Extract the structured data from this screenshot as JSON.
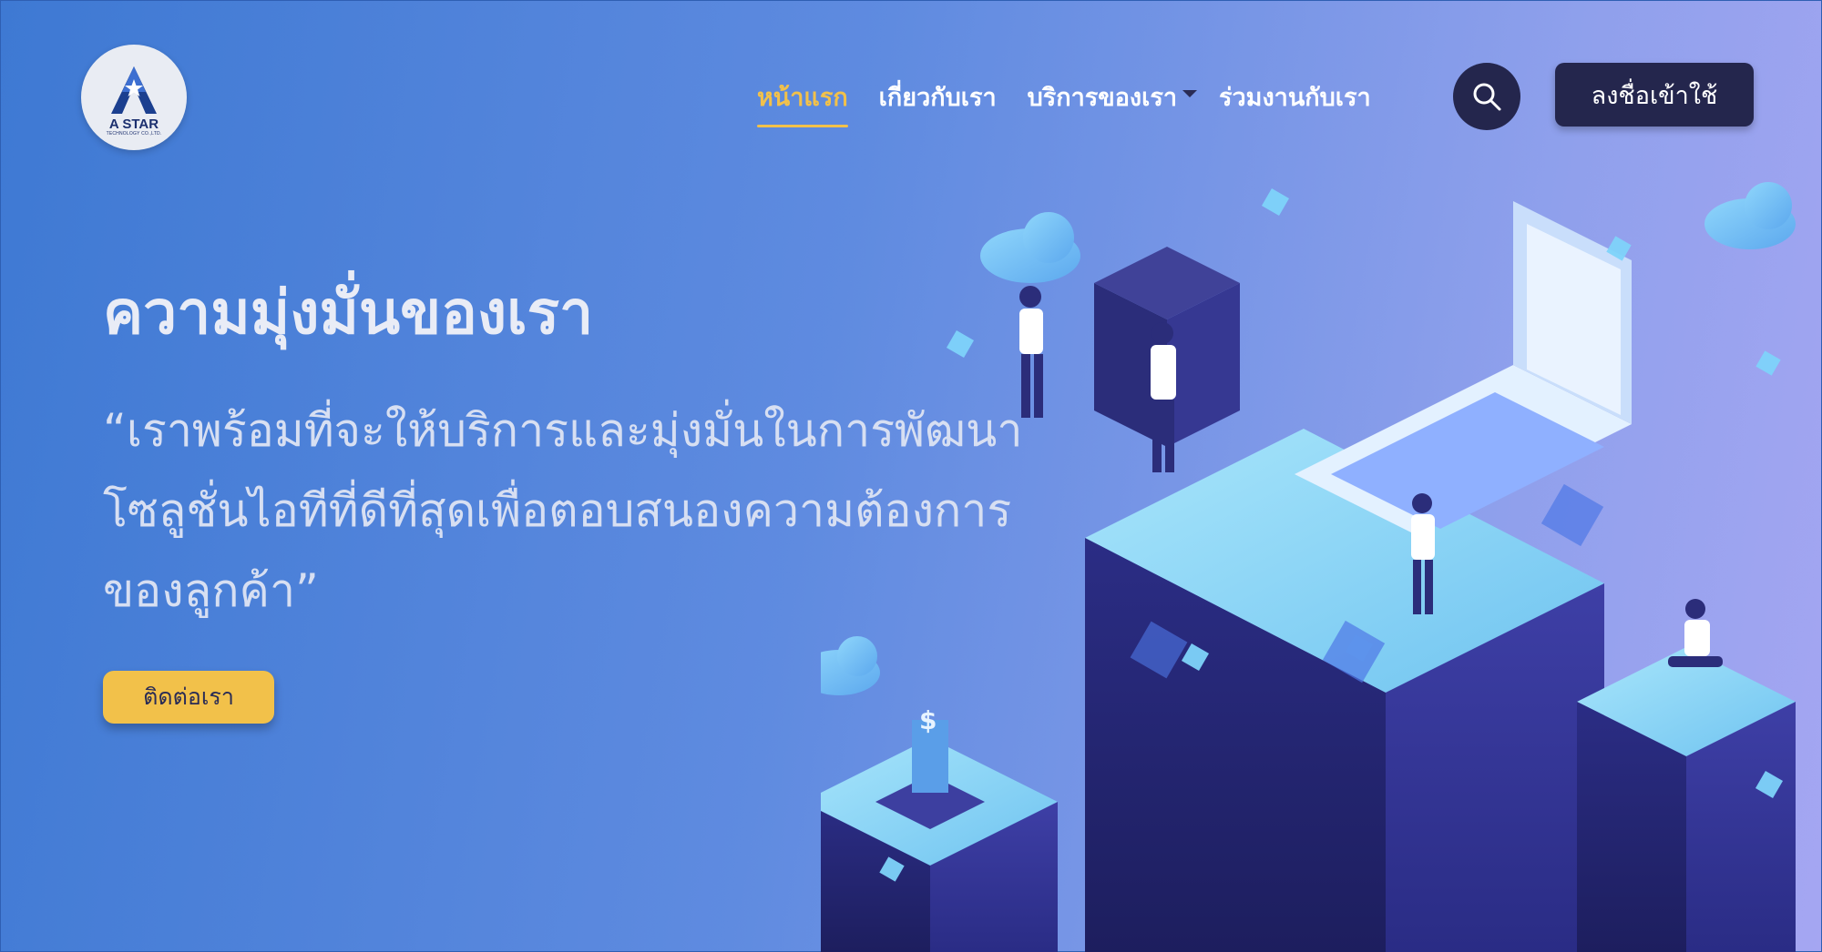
{
  "logo": {
    "name": "A STAR",
    "subtitle": "TECHNOLOGY CO.,LTD."
  },
  "nav": {
    "items": [
      {
        "label": "หน้าแรก",
        "active": true
      },
      {
        "label": "เกี่ยวกับเรา",
        "active": false
      },
      {
        "label": "บริการของเรา",
        "active": false,
        "dropdown": true
      },
      {
        "label": "ร่วมงานกับเรา",
        "active": false
      }
    ],
    "search_icon": "search-icon",
    "login_label": "ลงชื่อเข้าใช้"
  },
  "hero": {
    "title": "ความมุ่งมั่นของเรา",
    "quote_lines": [
      "“เราพร้อมที่จะให้บริการและมุ่งมั่นในการพัฒนา",
      "โซลูชั่นไอทีที่ดีที่สุดเพื่อตอบสนองความต้องการ",
      "ของลูกค้า”"
    ],
    "contact_label": "ติดต่อเรา"
  },
  "colors": {
    "accent": "#f2c14a",
    "dark": "#24264d",
    "gradient_start": "#3e79d3",
    "gradient_end": "#a5a6f2"
  }
}
